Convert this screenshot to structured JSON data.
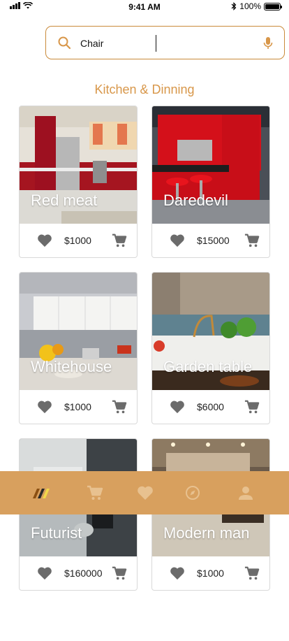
{
  "status_bar": {
    "time": "9:41 AM",
    "battery": "100%"
  },
  "search": {
    "value": "Chair",
    "placeholder": ""
  },
  "section": {
    "title": "Kitchen & Dinning"
  },
  "products": [
    {
      "name": "Red meat",
      "price": "$1000"
    },
    {
      "name": "Daredevil",
      "price": "$15000"
    },
    {
      "name": "Whitehouse",
      "price": "$1000"
    },
    {
      "name": "Garden table",
      "price": "$6000"
    },
    {
      "name": "Futurist",
      "price": "$160000"
    },
    {
      "name": "Modern man",
      "price": "$1000"
    }
  ],
  "nav": {
    "items": [
      "logo-icon",
      "cart-icon",
      "heart-icon",
      "compass-icon",
      "user-icon"
    ],
    "active": "logo-icon"
  },
  "colors": {
    "accent": "#d8974a",
    "nav_background": "#d8a05e",
    "search_border": "#c98a3a",
    "icon_gray": "#6b6b6b"
  }
}
